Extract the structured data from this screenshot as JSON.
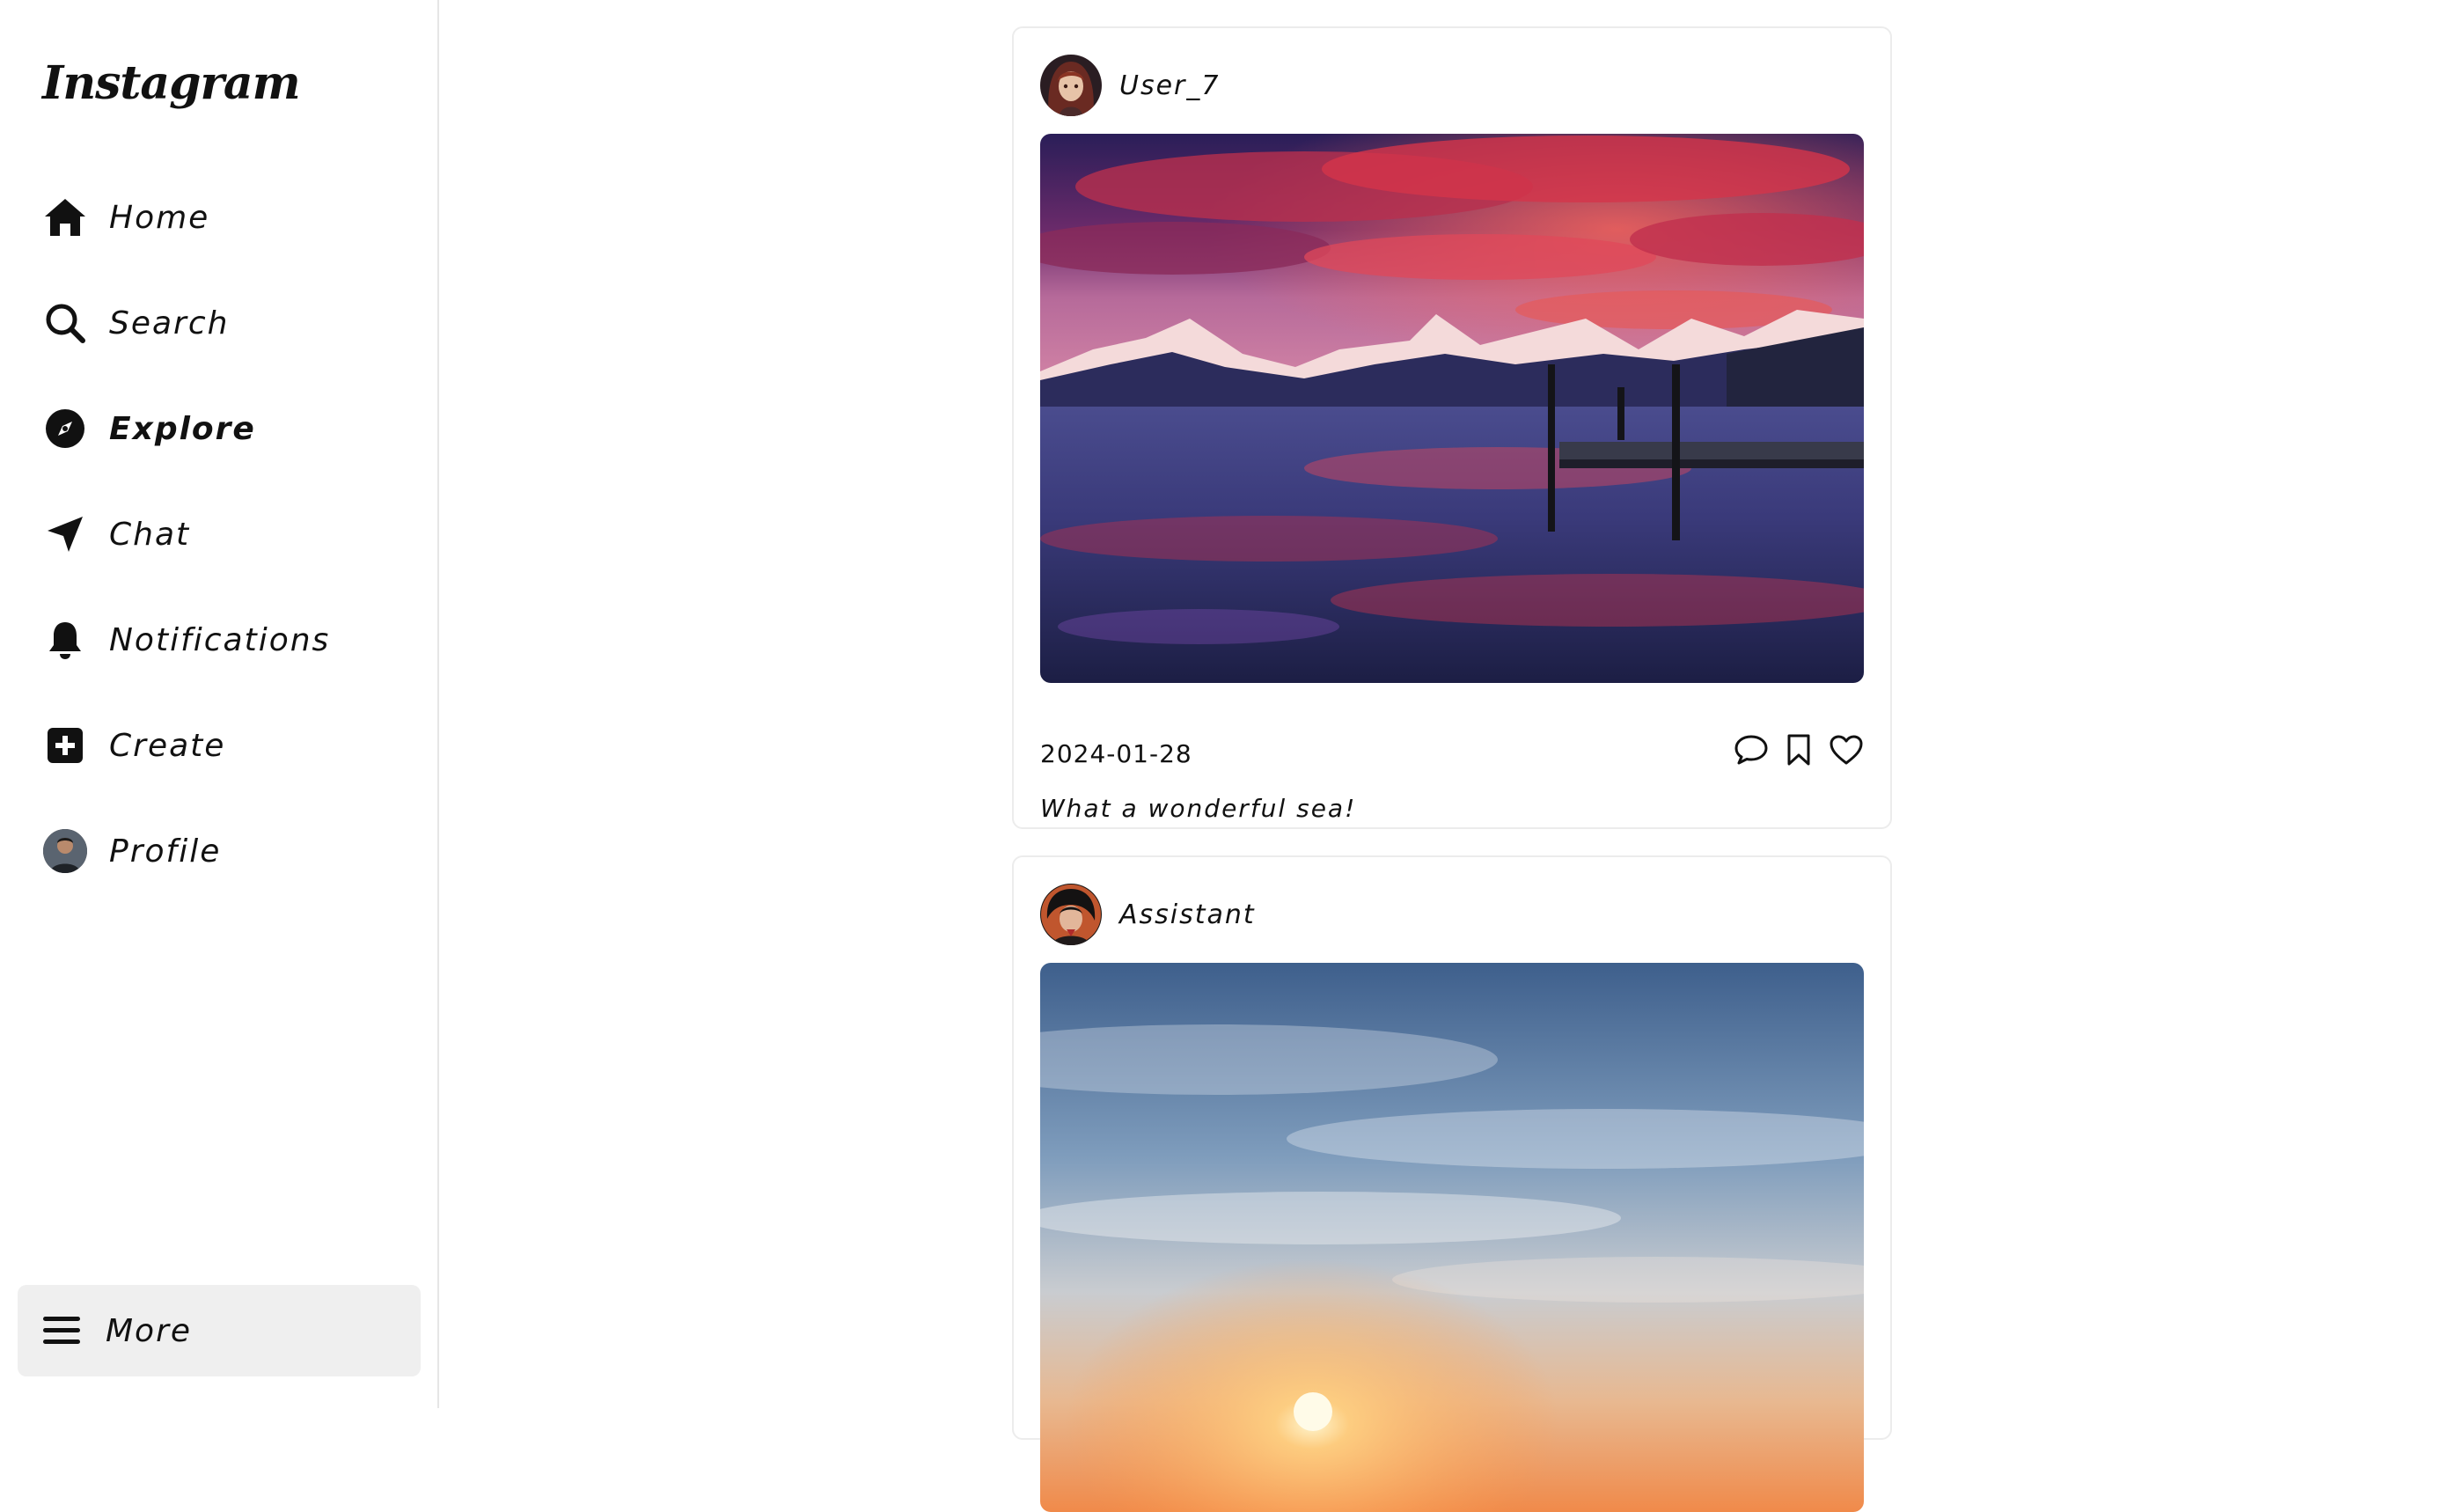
{
  "app": {
    "logo_text": "Instagram"
  },
  "sidebar": {
    "items": [
      {
        "label": "Home",
        "icon": "home-icon"
      },
      {
        "label": "Search",
        "icon": "search-icon"
      },
      {
        "label": "Explore",
        "icon": "compass-icon"
      },
      {
        "label": "Chat",
        "icon": "send-icon"
      },
      {
        "label": "Notifications",
        "icon": "bell-icon"
      },
      {
        "label": "Create",
        "icon": "plus-square-icon"
      },
      {
        "label": "Profile",
        "icon": "avatar"
      }
    ],
    "active": "Explore",
    "more_label": "More"
  },
  "feed": {
    "posts": [
      {
        "user": "User_7",
        "date": "2024-01-28",
        "caption": "What a wonderful sea!",
        "image": "mountain-lake-sunset-photo"
      },
      {
        "user": "Assistant",
        "image": "sky-sunset-clouds-photo"
      }
    ]
  },
  "colors": {
    "sidebar_border": "#e6e6e6",
    "more_bg": "#efefef",
    "post_border": "#ececec",
    "text": "#111111"
  }
}
